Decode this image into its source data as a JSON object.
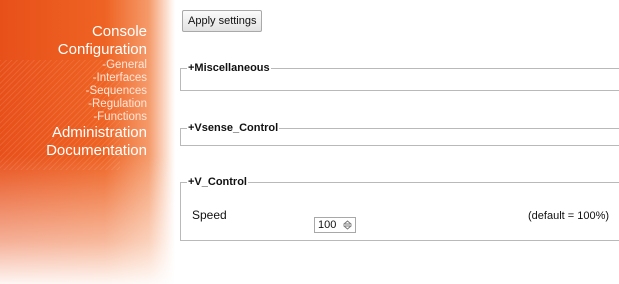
{
  "sidebar": {
    "items": [
      {
        "label": "Console",
        "level": "main"
      },
      {
        "label": "Configuration",
        "level": "main"
      },
      {
        "label": "-General",
        "level": "sub"
      },
      {
        "label": "-Interfaces",
        "level": "sub"
      },
      {
        "label": "-Sequences",
        "level": "sub"
      },
      {
        "label": "-Regulation",
        "level": "sub"
      },
      {
        "label": "-Functions",
        "level": "sub"
      },
      {
        "label": "Administration",
        "level": "main"
      },
      {
        "label": "Documentation",
        "level": "main"
      }
    ]
  },
  "toolbar": {
    "apply_label": "Apply settings"
  },
  "sections": {
    "misc": {
      "legend": "+Miscellaneous"
    },
    "vsense": {
      "legend": "+Vsense_Control"
    },
    "vcontrol": {
      "legend": "+V_Control",
      "speed_label": "Speed",
      "speed_value": "100",
      "default_note": "(default = 100%)"
    }
  },
  "icons": {
    "spinner": "up-down-spinner-icon"
  },
  "colors": {
    "sidebar_orange": "#e8501a",
    "sidebar_text": "#ffffff",
    "border": "#b9b9b9"
  }
}
